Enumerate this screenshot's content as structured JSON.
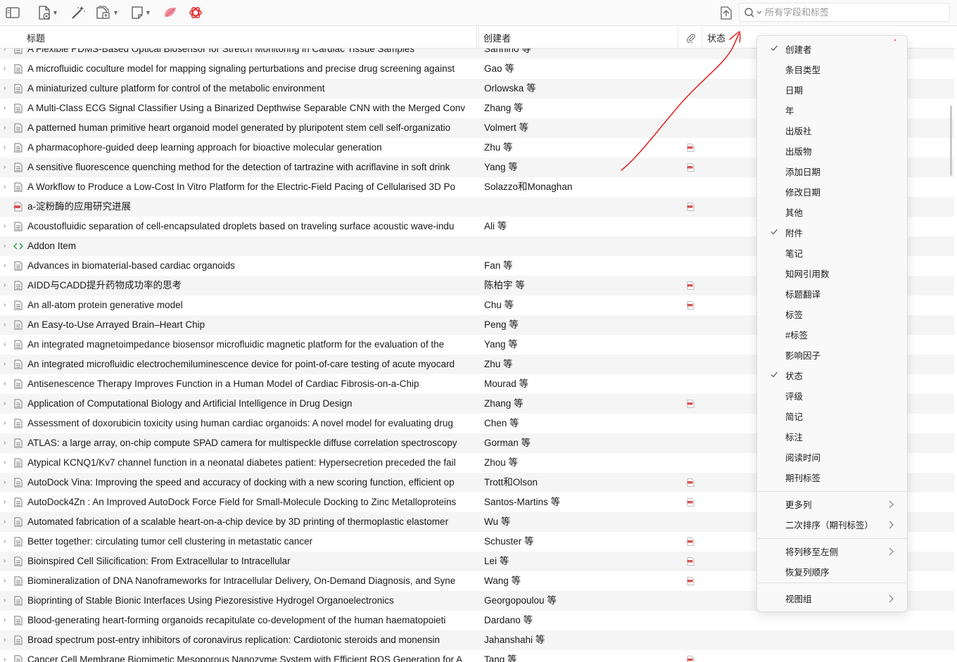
{
  "toolbar": {
    "search_placeholder": "所有字段和标签",
    "icons": [
      "pane-toggle-icon",
      "new-item-icon",
      "magic-wand-icon",
      "add-attachment-icon",
      "new-note-icon",
      "feather-icon",
      "openai-icon",
      "sync-icon",
      "search-icon"
    ]
  },
  "columns": {
    "title": "标题",
    "creator": "创建者",
    "status": "状态"
  },
  "rows": [
    {
      "title": "A Flexible PDMS-Based Optical Biosensor for Stretch Monitoring in Cardiac Tissue Samples",
      "creator": "Sannino 等",
      "type": "doc",
      "pdf": false
    },
    {
      "title": "A microfluidic coculture model for mapping signaling perturbations and precise drug screening against",
      "creator": "Gao 等",
      "type": "doc",
      "pdf": false
    },
    {
      "title": "A miniaturized culture platform for control of the metabolic environment",
      "creator": "Orlowska 等",
      "type": "doc",
      "pdf": false
    },
    {
      "title": "A Multi-Class ECG Signal Classifier Using a Binarized Depthwise Separable CNN with the Merged Conv",
      "creator": "Zhang 等",
      "type": "doc",
      "pdf": false
    },
    {
      "title": "A patterned human primitive heart organoid model generated by pluripotent stem cell self-organizatio",
      "creator": "Volmert 等",
      "type": "doc",
      "pdf": false
    },
    {
      "title": "A pharmacophore-guided deep learning approach for bioactive molecular generation",
      "creator": "Zhu 等",
      "type": "doc",
      "pdf": true
    },
    {
      "title": "A sensitive fluorescence quenching method for the detection of tartrazine with acriflavine in soft drink",
      "creator": "Yang 等",
      "type": "doc",
      "pdf": true
    },
    {
      "title": "A Workflow to Produce a Low-Cost In Vitro Platform for the Electric-Field Pacing of Cellularised 3D Po",
      "creator": "Solazzo和Monaghan",
      "type": "doc",
      "pdf": false
    },
    {
      "title": "a-淀粉酶的应用研究进展",
      "creator": "",
      "type": "pdf",
      "pdf": true
    },
    {
      "title": "Acoustofluidic separation of cell-encapsulated droplets based on traveling surface acoustic wave-indu",
      "creator": "Ali 等",
      "type": "doc",
      "pdf": false
    },
    {
      "title": "Addon Item",
      "creator": "",
      "type": "code",
      "pdf": false
    },
    {
      "title": "Advances in biomaterial-based cardiac organoids",
      "creator": "Fan 等",
      "type": "doc",
      "pdf": false
    },
    {
      "title": "AIDD与CADD提升药物成功率的思考",
      "creator": "陈柏宇 等",
      "type": "doc",
      "pdf": true
    },
    {
      "title": "An all-atom protein generative model",
      "creator": "Chu 等",
      "type": "doc",
      "pdf": true
    },
    {
      "title": "An Easy-to-Use Arrayed Brain–Heart Chip",
      "creator": "Peng 等",
      "type": "doc",
      "pdf": false
    },
    {
      "title": "An integrated magnetoimpedance biosensor microfluidic magnetic platform for the evaluation of the",
      "creator": "Yang 等",
      "type": "doc",
      "pdf": false
    },
    {
      "title": "An integrated microfluidic electrochemiluminescence device for point-of-care testing of acute myocard",
      "creator": "Zhu 等",
      "type": "doc",
      "pdf": false
    },
    {
      "title": "Antisenescence Therapy Improves Function in a Human Model of Cardiac Fibrosis-on-a-Chip",
      "creator": "Mourad 等",
      "type": "doc",
      "pdf": false
    },
    {
      "title": "Application of Computational Biology and Artificial Intelligence in Drug Design",
      "creator": "Zhang 等",
      "type": "doc",
      "pdf": true
    },
    {
      "title": "Assessment of doxorubicin toxicity using human cardiac organoids: A novel model for evaluating drug",
      "creator": "Chen 等",
      "type": "doc",
      "pdf": false
    },
    {
      "title": "ATLAS: a large array, on-chip compute SPAD camera for multispeckle diffuse correlation spectroscopy",
      "creator": "Gorman 等",
      "type": "doc",
      "pdf": false
    },
    {
      "title": "Atypical KCNQ1/Kv7 channel function in a neonatal diabetes patient: Hypersecretion preceded the fail",
      "creator": "Zhou 等",
      "type": "doc",
      "pdf": false
    },
    {
      "title": "AutoDock Vina: Improving the speed and accuracy of docking with a new scoring function, efficient op",
      "creator": "Trott和Olson",
      "type": "doc",
      "pdf": true
    },
    {
      "title": "AutoDock4Zn : An Improved AutoDock Force Field for Small-Molecule Docking to Zinc Metalloproteins",
      "creator": "Santos-Martins 等",
      "type": "doc",
      "pdf": true
    },
    {
      "title": "Automated fabrication of a scalable heart-on-a-chip device by 3D printing of thermoplastic elastomer",
      "creator": "Wu 等",
      "type": "doc",
      "pdf": false
    },
    {
      "title": "Better together: circulating tumor cell clustering in metastatic cancer",
      "creator": "Schuster 等",
      "type": "doc",
      "pdf": true
    },
    {
      "title": "Bioinspired Cell Silicification: From Extracellular to Intracellular",
      "creator": "Lei 等",
      "type": "doc",
      "pdf": true
    },
    {
      "title": "Biomineralization of DNA Nanoframeworks for Intracellular Delivery, On-Demand Diagnosis, and Syne",
      "creator": "Wang 等",
      "type": "doc",
      "pdf": true
    },
    {
      "title": "Bioprinting of Stable Bionic Interfaces Using Piezoresistive Hydrogel Organoelectronics",
      "creator": "Georgopoulou 等",
      "type": "doc",
      "pdf": false
    },
    {
      "title": "Blood-generating heart-forming organoids recapitulate co-development of the human haematopoieti",
      "creator": "Dardano 等",
      "type": "doc",
      "pdf": false
    },
    {
      "title": "Broad spectrum post-entry inhibitors of coronavirus replication: Cardiotonic steroids and monensin",
      "creator": "Jahanshahi 等",
      "type": "doc",
      "pdf": false
    },
    {
      "title": "Cancer Cell Membrane Biomimetic Mesoporous Nanozyme System with Efficient ROS Generation for A",
      "creator": "Tang 等",
      "type": "doc",
      "pdf": true
    }
  ],
  "menu": {
    "items": [
      {
        "label": "创建者",
        "checked": true
      },
      {
        "label": "条目类型",
        "checked": false
      },
      {
        "label": "日期",
        "checked": false
      },
      {
        "label": "年",
        "checked": false
      },
      {
        "label": "出版社",
        "checked": false
      },
      {
        "label": "出版物",
        "checked": false
      },
      {
        "label": "添加日期",
        "checked": false
      },
      {
        "label": "修改日期",
        "checked": false
      },
      {
        "label": "其他",
        "checked": false
      },
      {
        "label": "附件",
        "checked": true
      },
      {
        "label": "笔记",
        "checked": false
      },
      {
        "label": "知网引用数",
        "checked": false
      },
      {
        "label": "标题翻译",
        "checked": false
      },
      {
        "label": "标签",
        "checked": false
      },
      {
        "label": "#标签",
        "checked": false
      },
      {
        "label": "影响因子",
        "checked": false
      },
      {
        "label": "状态",
        "checked": true
      },
      {
        "label": "评级",
        "checked": false
      },
      {
        "label": "简记",
        "checked": false
      },
      {
        "label": "标注",
        "checked": false
      },
      {
        "label": "阅读时间",
        "checked": false
      },
      {
        "label": "期刊标签",
        "checked": false
      }
    ],
    "more_columns": "更多列",
    "secondary_sort": "二次排序（期刊标签）",
    "move_column_left": "将列移至左侧",
    "restore_order": "恢复列顺序",
    "view_groups": "视图组"
  },
  "colors": {
    "annotation_red": "#e02020",
    "pdf_red": "#d9534f",
    "code_green": "#2e9e4f"
  }
}
